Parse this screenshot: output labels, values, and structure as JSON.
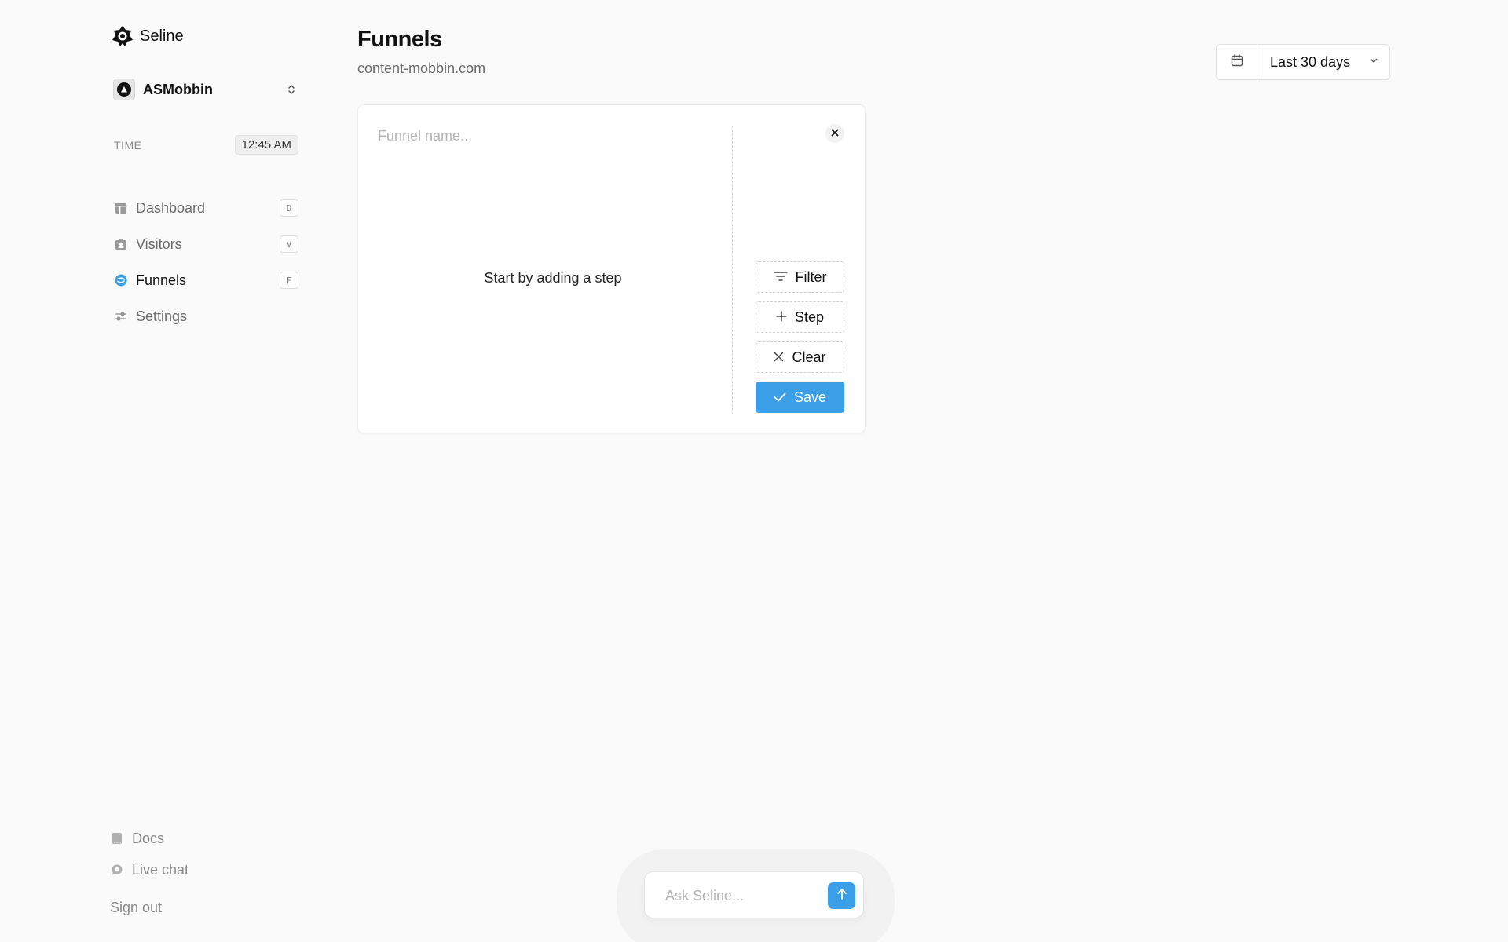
{
  "app": {
    "name": "Seline"
  },
  "workspace": {
    "name": "ASMobbin"
  },
  "time": {
    "label": "TIME",
    "value": "12:45 AM"
  },
  "nav": {
    "items": [
      {
        "label": "Dashboard",
        "shortcut": "D",
        "icon": "layout-icon",
        "active": false
      },
      {
        "label": "Visitors",
        "shortcut": "V",
        "icon": "users-icon",
        "active": false
      },
      {
        "label": "Funnels",
        "shortcut": "F",
        "icon": "funnel-icon",
        "active": true
      },
      {
        "label": "Settings",
        "shortcut": "",
        "icon": "sliders-icon",
        "active": false
      }
    ]
  },
  "sidebar_bottom": {
    "docs": "Docs",
    "live_chat": "Live chat",
    "sign_out": "Sign out"
  },
  "page": {
    "title": "Funnels",
    "subtitle": "content-mobbin.com"
  },
  "date_range": {
    "label": "Last 30 days"
  },
  "funnel": {
    "name_placeholder": "Funnel name...",
    "empty_text": "Start by adding a step",
    "actions": {
      "filter": "Filter",
      "step": "Step",
      "clear": "Clear",
      "save": "Save"
    }
  },
  "ask": {
    "placeholder": "Ask Seline..."
  },
  "colors": {
    "accent": "#3b9fe8",
    "background": "#fafafa",
    "text": "#111111",
    "muted": "#6b6b6b"
  }
}
